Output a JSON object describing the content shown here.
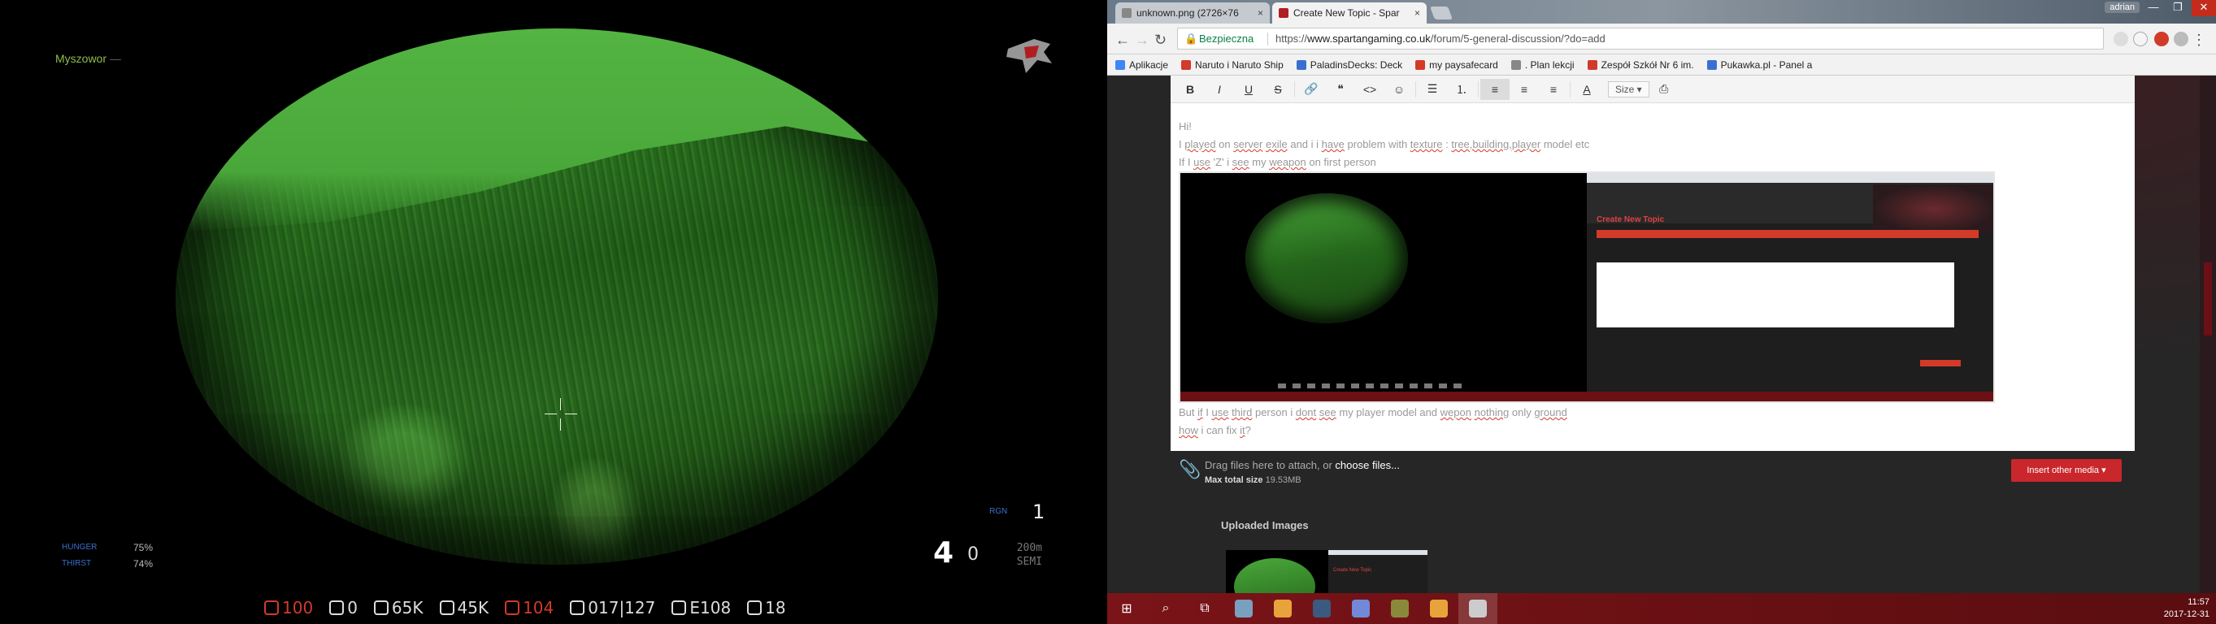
{
  "game": {
    "player_name": "Myszowor",
    "stats": [
      {
        "label": "HUNGER",
        "value": "75%"
      },
      {
        "label": "THIRST",
        "value": "74%"
      }
    ],
    "rgn_label": "RGN",
    "rgn_value": "1",
    "magazine_count": "4",
    "magazine_zero": "0",
    "range_top": "200m",
    "range_mode": "SEMI",
    "hud_items": [
      {
        "icon": "blood-icon",
        "value": "100",
        "color": "#d23a2a"
      },
      {
        "icon": "temperature-icon",
        "value": "0",
        "color": "#dddddd"
      },
      {
        "icon": "wallet-icon",
        "value": "65K",
        "color": "#dddddd"
      },
      {
        "icon": "bank-icon",
        "value": "45K",
        "color": "#dddddd"
      },
      {
        "icon": "fps-icon",
        "value": "104",
        "color": "#d23a2a"
      },
      {
        "icon": "location-icon",
        "value": "017|127",
        "color": "#dddddd"
      },
      {
        "icon": "compass-icon",
        "value": "E108",
        "color": "#dddddd"
      },
      {
        "icon": "players-icon",
        "value": "18",
        "color": "#dddddd"
      }
    ]
  },
  "browser": {
    "tabs": [
      {
        "title": "unknown.png (2726×76",
        "close": "×"
      },
      {
        "title": "Create New Topic - Spar",
        "close": "×"
      }
    ],
    "user": "adrian",
    "window_buttons": [
      "—",
      "❐",
      "✕"
    ],
    "secure_label": "Bezpieczna",
    "url_prefix": "https://",
    "url_host": "www.spartangaming.co.uk",
    "url_path": "/forum/5-general-discussion/?do=add",
    "bookmarks": [
      {
        "label": "Aplikacje",
        "color": "#4285f4"
      },
      {
        "label": "Naruto i Naruto Ship",
        "color": "#d23a2a"
      },
      {
        "label": "PaladinsDecks: Deck",
        "color": "#3a6fd0"
      },
      {
        "label": "my paysafecard",
        "color": "#d23a2a"
      },
      {
        "label": ". Plan lekcji",
        "color": "#888888"
      },
      {
        "label": "Zespół Szkół Nr 6 im.",
        "color": "#d23a2a"
      },
      {
        "label": "Pukawka.pl - Panel a",
        "color": "#3a6fd0"
      }
    ],
    "toolbar": {
      "bold": "B",
      "italic": "I",
      "underline": "U",
      "strike": "S",
      "link": "🔗",
      "quote": "❝",
      "code": "<>",
      "emoji": "☺",
      "bullets": "☰",
      "numbered": "⒈",
      "align_left": "≡",
      "align_center": "≡",
      "align_right": "≡",
      "color": "A",
      "size": "Size ▾",
      "preview": "⎙"
    },
    "post": {
      "line1": "Hi!",
      "line2_parts": [
        {
          "t": "I ",
          "u": false
        },
        {
          "t": "played",
          "u": true
        },
        {
          "t": " on ",
          "u": false
        },
        {
          "t": "server",
          "u": true
        },
        {
          "t": " ",
          "u": false
        },
        {
          "t": "exile",
          "u": true
        },
        {
          "t": " and i i ",
          "u": false
        },
        {
          "t": "have",
          "u": true
        },
        {
          "t": " problem with ",
          "u": false
        },
        {
          "t": "texture",
          "u": true
        },
        {
          "t": " : ",
          "u": false
        },
        {
          "t": "tree,building,player",
          "u": true
        },
        {
          "t": " model etc",
          "u": false
        }
      ],
      "line3_parts": [
        {
          "t": "If I ",
          "u": false
        },
        {
          "t": "use",
          "u": true
        },
        {
          "t": " 'Z' i ",
          "u": false
        },
        {
          "t": "see",
          "u": true
        },
        {
          "t": " my ",
          "u": false
        },
        {
          "t": "weapon",
          "u": true
        },
        {
          "t": " on first person",
          "u": false
        }
      ],
      "line4_parts": [
        {
          "t": "But ",
          "u": false
        },
        {
          "t": "if",
          "u": true
        },
        {
          "t": " I ",
          "u": false
        },
        {
          "t": "use",
          "u": true
        },
        {
          "t": " ",
          "u": false
        },
        {
          "t": "third",
          "u": true
        },
        {
          "t": " person i ",
          "u": false
        },
        {
          "t": "dont",
          "u": true
        },
        {
          "t": " ",
          "u": false
        },
        {
          "t": "see",
          "u": true
        },
        {
          "t": " my player model and ",
          "u": false
        },
        {
          "t": "wepon",
          "u": true
        },
        {
          "t": " ",
          "u": false
        },
        {
          "t": "nothing",
          "u": true
        },
        {
          "t": " only ",
          "u": false
        },
        {
          "t": "ground",
          "u": true
        }
      ],
      "line5_parts": [
        {
          "t": "how",
          "u": true
        },
        {
          "t": " i can fix ",
          "u": false
        },
        {
          "t": "it",
          "u": true
        },
        {
          "t": "?",
          "u": false
        }
      ],
      "embedded_title": "Create New Topic"
    },
    "attach": {
      "drag_text": "Drag files here to attach, or ",
      "choose_link": "choose files...",
      "max_label": "Max total size",
      "max_value": "19.53MB"
    },
    "insert_media": "Insert other media ▾",
    "uploaded_title": "Uploaded Images",
    "taskbar_icons": [
      {
        "name": "windows-start-icon",
        "glyph": "⊞",
        "color": "#ffffff"
      },
      {
        "name": "search-icon",
        "glyph": "⌕",
        "color": "#ffffff"
      },
      {
        "name": "task-view-icon",
        "glyph": "⧉",
        "color": "#ffffff"
      },
      {
        "name": "file-explorer-icon",
        "glyph": "",
        "color": "#7aa0c0"
      },
      {
        "name": "chrome-icon",
        "glyph": "",
        "color": "#e8a33a"
      },
      {
        "name": "steam-icon",
        "glyph": "",
        "color": "#3a5a80"
      },
      {
        "name": "discord-icon",
        "glyph": "",
        "color": "#7289da"
      },
      {
        "name": "arma-launcher-icon",
        "glyph": "",
        "color": "#8a8a3a"
      },
      {
        "name": "chrome-icon-2",
        "glyph": "",
        "color": "#e8a33a"
      },
      {
        "name": "arma-game-icon",
        "glyph": "",
        "color": "#cccccc"
      }
    ],
    "clock_time": "11:57",
    "clock_date": "2017-12-31"
  }
}
